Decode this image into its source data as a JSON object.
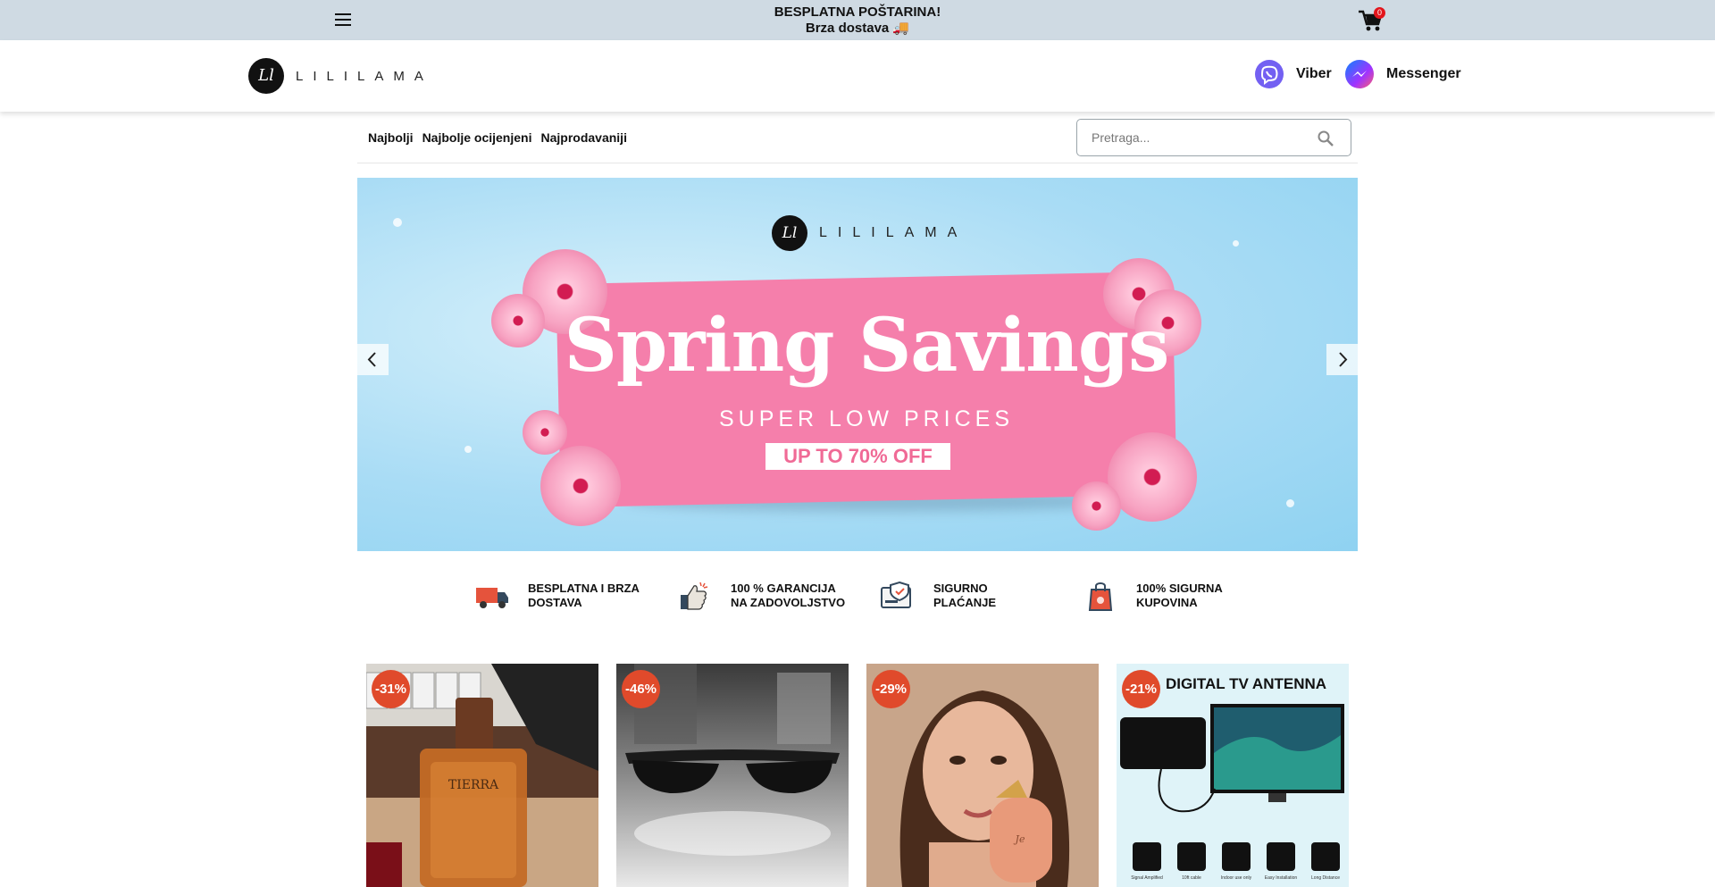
{
  "topbar": {
    "announcement_line1": "BESPLATNA POŠTARINA!",
    "announcement_line2": "Brza dostava 🚚",
    "cart_count": "0",
    "bg_color": "#cfdae3"
  },
  "header": {
    "logo_text": "LILILAMA",
    "logo_monogram": "Ll",
    "viber_label": "Viber",
    "messenger_label": "Messenger"
  },
  "nav": {
    "items": [
      {
        "label": "Najbolji"
      },
      {
        "label": "Najbolje ocijenjeni"
      },
      {
        "label": "Najprodavaniji"
      }
    ]
  },
  "search": {
    "placeholder": "Pretraga..."
  },
  "hero": {
    "logo_text": "LILILAMA",
    "title": "Spring Savings",
    "subtitle": "SUPER LOW PRICES",
    "cta": "UP TO 70% OFF"
  },
  "features": [
    {
      "text": "BESPLATNA I BRZA DOSTAVA",
      "icon": "truck-icon"
    },
    {
      "text": "100 % GARANCIJA NA ZADOVOLJSTVO",
      "icon": "thumbs-up-icon"
    },
    {
      "text": "SIGURNO PLAĆANJE",
      "icon": "secure-card-icon"
    },
    {
      "text": "100% SIGURNA KUPOVINA",
      "icon": "shopping-bag-icon"
    }
  ],
  "products": [
    {
      "discount": "-31%",
      "image": "perfume-bottle",
      "image_label": "TIERRA"
    },
    {
      "discount": "-46%",
      "image": "sunglasses"
    },
    {
      "discount": "-29%",
      "image": "woman-with-perfume"
    },
    {
      "discount": "-21%",
      "image": "digital-tv-antenna",
      "image_title": "DIGITAL TV ANTENNA",
      "image_features": [
        "Signal Amplified",
        "10ft cable",
        "Indoor use only",
        "Easy Installation",
        "Long Distance"
      ]
    }
  ],
  "colors": {
    "accent_discount": "#e04a2b",
    "cart_badge": "#e3151c",
    "hero_pink": "#f57fab"
  }
}
